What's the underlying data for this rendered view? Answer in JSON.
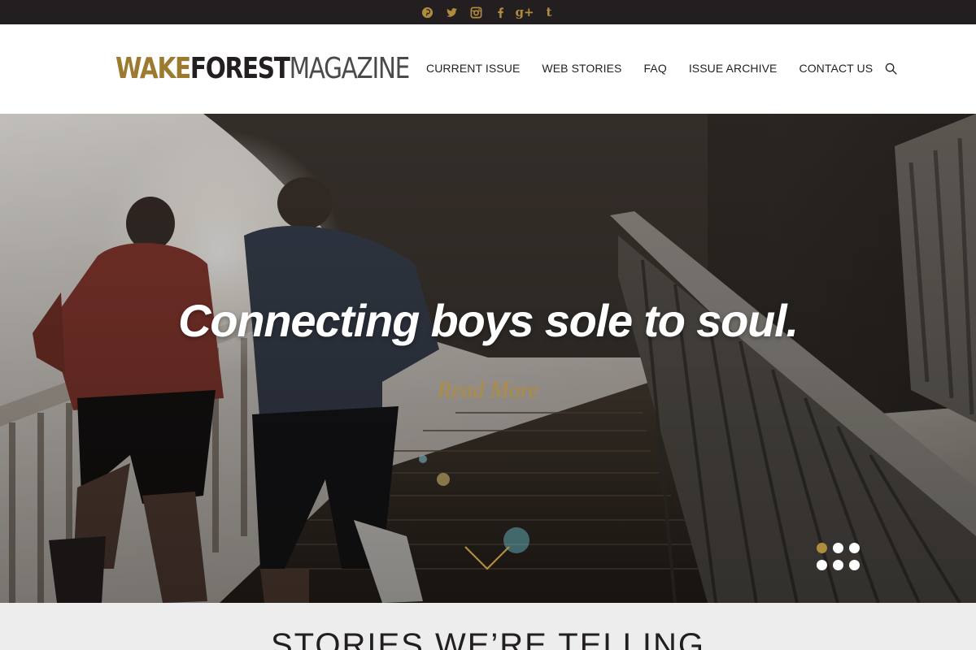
{
  "social": [
    {
      "name": "pinterest-icon"
    },
    {
      "name": "twitter-icon"
    },
    {
      "name": "instagram-icon"
    },
    {
      "name": "facebook-icon"
    },
    {
      "name": "google-plus-icon",
      "glyph": "g+"
    },
    {
      "name": "tumblr-icon",
      "glyph": "t"
    }
  ],
  "brand": {
    "part1": "WAKE",
    "part2": "FOREST",
    "part3": "MAGAZINE",
    "colors": {
      "gold": "#9c7a30",
      "black": "#231f20",
      "gray": "#4a4a4a"
    }
  },
  "nav": {
    "items": [
      "CURRENT ISSUE",
      "WEB STORIES",
      "FAQ",
      "ISSUE ARCHIVE",
      "CONTACT US"
    ],
    "search_icon": "search-icon"
  },
  "hero": {
    "headline": "Connecting boys sole to soul.",
    "cta": "Read More",
    "scroll_icon": "chevron-down-icon",
    "slides": 6,
    "active_slide": 1
  },
  "section": {
    "heading": "STORIES WE’RE TELLING"
  },
  "colors": {
    "topbar": "#231f20",
    "accent_gold": "#b08d3e",
    "section_bg": "#ededed"
  }
}
